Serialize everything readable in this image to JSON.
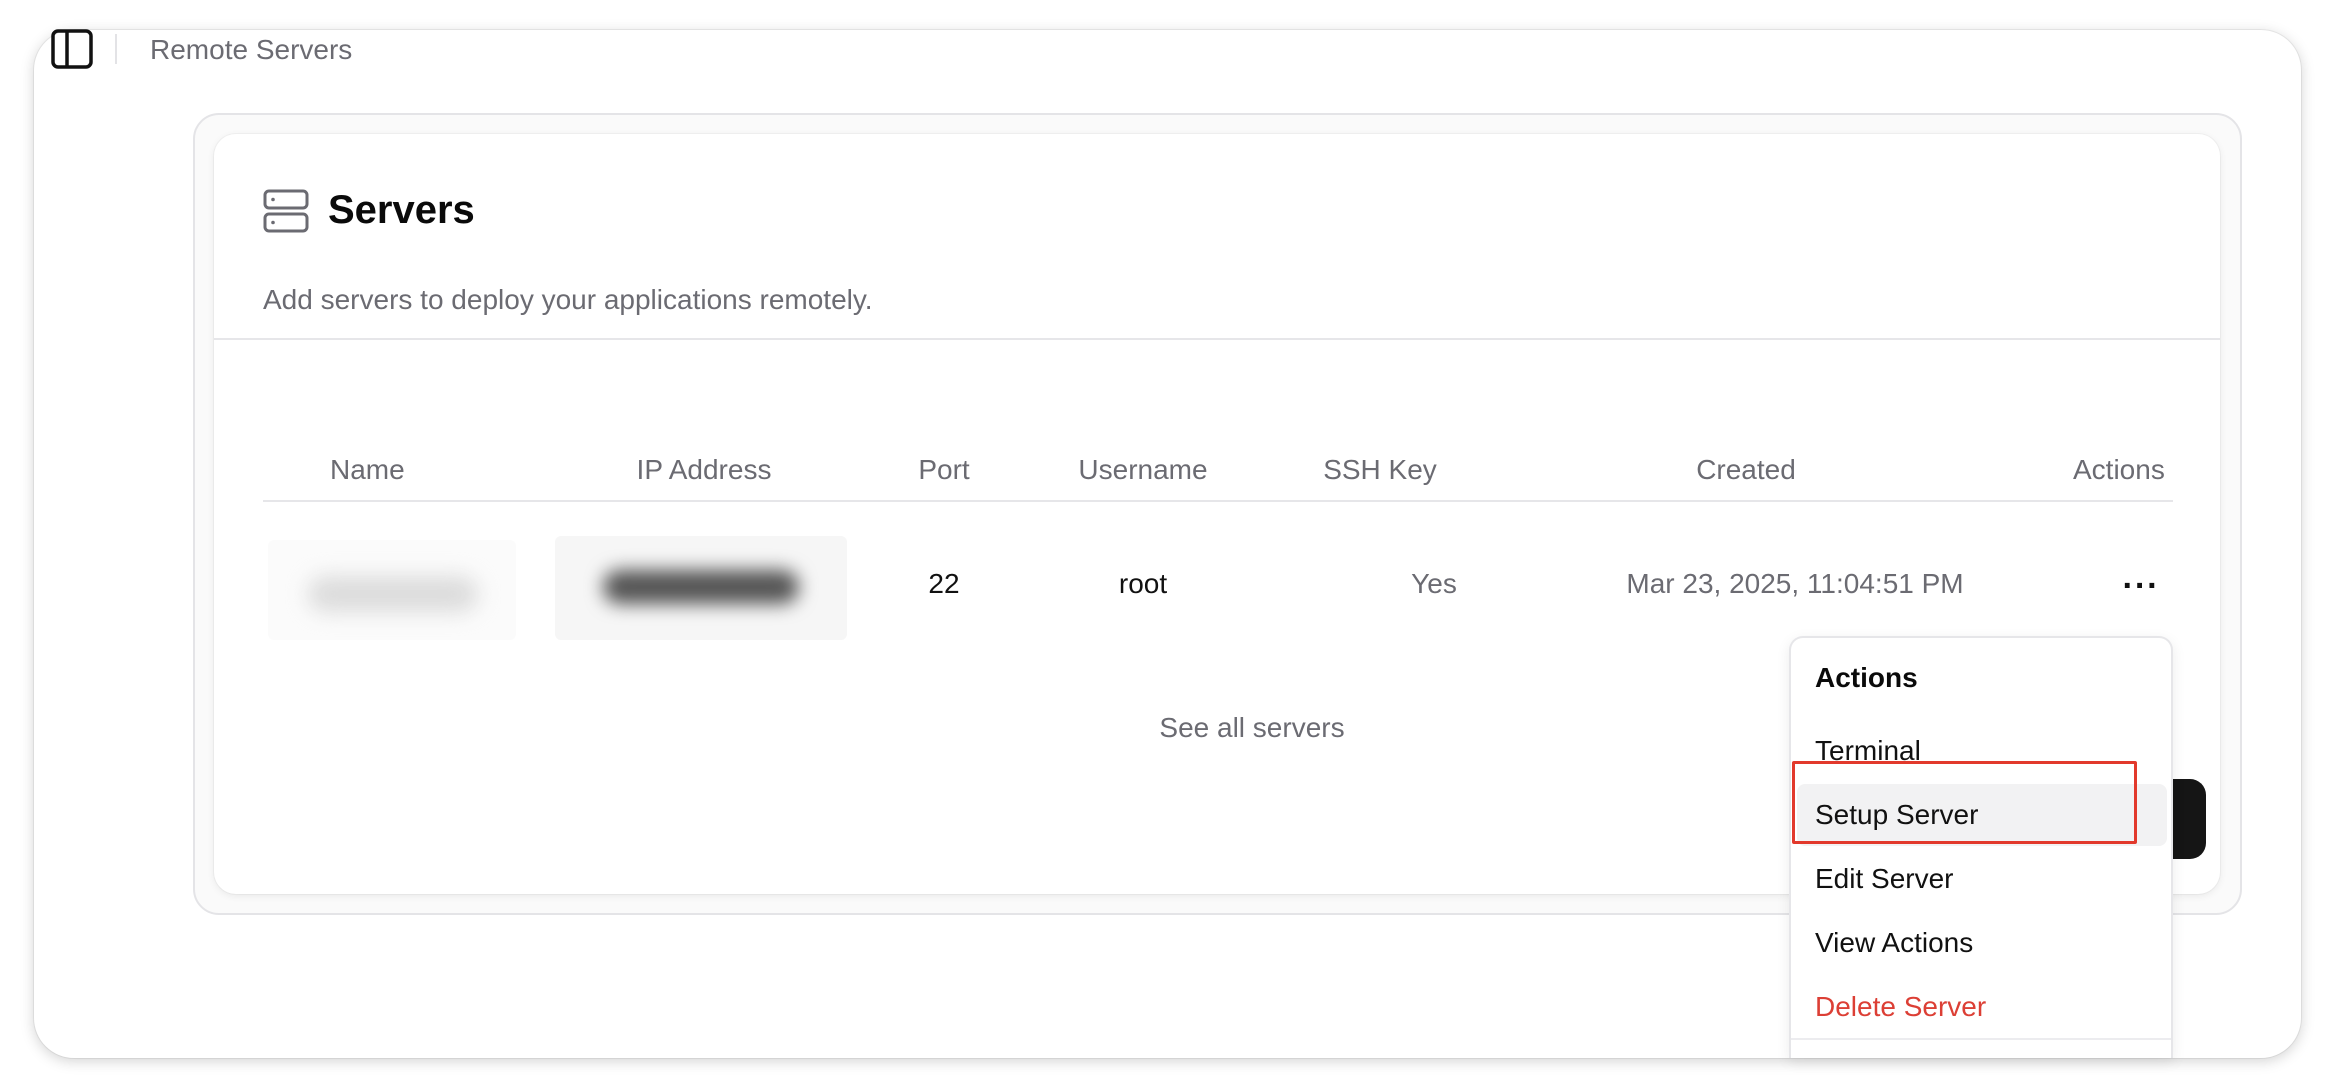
{
  "topbar": {
    "title": "Remote Servers",
    "sidebar_toggle_icon": "sidebar-panel-icon"
  },
  "card": {
    "icon": "server-stack-icon",
    "title": "Servers",
    "description": "Add servers to deploy your applications remotely."
  },
  "table": {
    "headers": {
      "name": "Name",
      "ip": "IP Address",
      "port": "Port",
      "username": "Username",
      "ssh_key": "SSH Key",
      "created": "Created",
      "actions": "Actions"
    },
    "rows": [
      {
        "port": "22",
        "username": "root",
        "ssh_key": "Yes",
        "created": "Mar 23, 2025, 11:04:51 PM",
        "more_icon": "ellipsis-icon",
        "more_label": "···"
      }
    ]
  },
  "footer": {
    "see_all": "See all servers"
  },
  "actions_menu": {
    "label": "Actions",
    "items": [
      {
        "label": "Terminal"
      },
      {
        "label": "Setup Server",
        "highlighted": true
      },
      {
        "label": "Edit Server"
      },
      {
        "label": "View Actions"
      },
      {
        "label": "Delete Server",
        "variant": "danger"
      }
    ]
  },
  "colors": {
    "muted_text": "#6b6b72",
    "danger": "#dc3f35",
    "highlight_outline": "#e2392c",
    "primary_button": "#151515"
  }
}
